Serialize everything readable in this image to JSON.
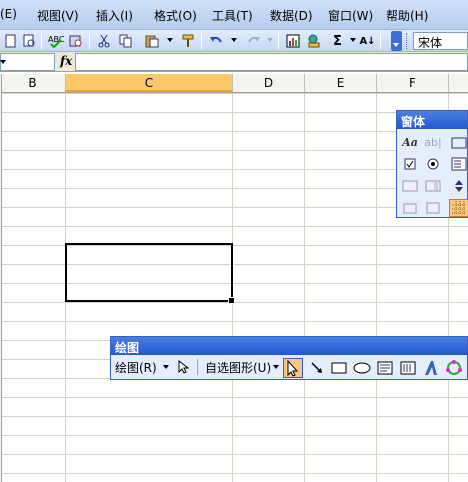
{
  "menu": {
    "items": [
      "(E)",
      "视图(V)",
      "插入(I)",
      "格式(O)",
      "工具(T)",
      "数据(D)",
      "窗口(W)",
      "帮助(H)"
    ]
  },
  "toolbar": {
    "font_name": "宋体",
    "icons": [
      "new-icon",
      "print-preview-icon",
      "spelling-icon",
      "research-icon",
      "cut-icon",
      "copy-icon",
      "paste-icon",
      "format-painter-icon",
      "undo-icon",
      "redo-icon",
      "chart-wizard-icon",
      "drawing-icon",
      "autosum-icon",
      "sort-ascending-icon"
    ],
    "autosum_glyph": "Σ",
    "sort_glyph": "A↓"
  },
  "formula_bar": {
    "fx": "fx",
    "name_box": "",
    "content": ""
  },
  "sheet": {
    "columns": [
      "B",
      "C",
      "D",
      "E",
      "F"
    ],
    "active_column": "C"
  },
  "forms_toolbar": {
    "title": "窗体",
    "icons": [
      "label-icon",
      "edit-box-icon",
      "group-box-icon",
      "checkbox-icon",
      "option-button-icon",
      "list-box-icon",
      "combo-box-icon",
      "scroll-bar-icon",
      "spinner-icon",
      "properties-icon",
      "edit-code-icon",
      "toggle-grid-icon"
    ],
    "label_glyph": "Aa",
    "edit_glyph": "ab|"
  },
  "drawing_toolbar": {
    "title": "绘图",
    "draw_label": "绘图(R)",
    "autoshapes_label": "自选图形(U)",
    "icons": [
      "select-objects-icon",
      "arrow-icon",
      "rectangle-icon",
      "oval-icon",
      "text-box-icon",
      "vertical-text-box-icon",
      "wordart-icon",
      "diagram-icon"
    ]
  }
}
